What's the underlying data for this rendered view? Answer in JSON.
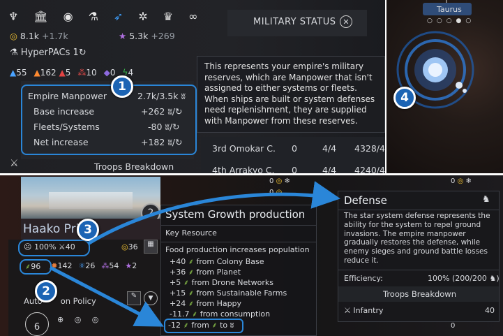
{
  "top_left": {
    "icons": [
      "laurel-icon",
      "museum-icon",
      "coins-icon",
      "flask-icon",
      "arrow-icon",
      "gear-sun-icon",
      "trophy-icon",
      "handshake-icon"
    ],
    "money": "8.1k",
    "money_rate": "+1.7k",
    "influence": "5.3k",
    "influence_rate": "+269",
    "hyperpacs_label": "HyperPACs",
    "hyperpacs_value": "1",
    "stat_55": "55",
    "stat_162": "162",
    "stat_5": "5",
    "stat_10": "10",
    "stat_0": "0",
    "stat_4": "4",
    "manpower_label": "Empire Manpower",
    "manpower_value": "2.7k/3.5k",
    "base_label": "Base increase",
    "base_value": "+262",
    "fleets_label": "Fleets/Systems",
    "fleets_value": "-80",
    "net_label": "Net increase",
    "net_value": "+182",
    "troops_label": "Troops Breakdown",
    "military_title": "MILITARY STATUS",
    "tooltip": "This represents your empire's military reserves, which are Manpower that isn't assigned to either systems or fleets. When ships are built or system defenses need replenishment, they are supplied with Manpower from these reserves.",
    "fleet_rows": [
      {
        "name": "3rd Omokar C.",
        "slot": "0",
        "ratio": "4/4",
        "power": "4328/4"
      },
      {
        "name": "4th Arrakyo C.",
        "slot": "0",
        "ratio": "4/4",
        "power": "4240/4"
      }
    ]
  },
  "top_right": {
    "system_name": "Taurus"
  },
  "bottom": {
    "system_name": "Haako Pri",
    "level": "2",
    "pop_pct": "100%",
    "pop_value": "40",
    "food": "96",
    "industry": "142",
    "science": "26",
    "influence": "54",
    "dust": "2",
    "stars": "36",
    "auto_label": "Auto",
    "policy_label": "on Policy",
    "bottom_pop": "6",
    "growth_title": "System Growth production",
    "key_resource": "Key Resource",
    "food_header": "Food production increases population",
    "growth_lines": [
      {
        "value": "+40",
        "text": "from Colony Base"
      },
      {
        "value": "+36",
        "text": "from Planet"
      },
      {
        "value": "+5",
        "text": "from Drone Networks"
      },
      {
        "value": "+15",
        "text": "from Sustainable Farms"
      },
      {
        "value": "+24",
        "text": "from Happy"
      },
      {
        "value": "-11.7",
        "text": "from consumption"
      }
    ],
    "last_line": {
      "value": "-12",
      "mid": "from",
      "end": "to"
    },
    "map_zero_1": "0",
    "map_zero_2": "0",
    "map_zero_3": "0",
    "map_zero_4": "0",
    "defense_title": "Defense",
    "defense_text": "The star system defense represents the ability for the system to repel ground invasions. The empire manpower gradually restores the defense, while enemy sieges and ground battle losses reduce it.",
    "efficiency_label": "Efficiency:",
    "efficiency_value": "100% (200/200",
    "troops_label": "Troops Breakdown",
    "infantry_label": "Infantry",
    "infantry_value": "40"
  },
  "badges": [
    "1",
    "2",
    "3",
    "4"
  ],
  "colors": {
    "accent": "#2a86d8",
    "food": "#8bc34a",
    "gold": "#f1c232",
    "bg": "#1b1d21"
  }
}
